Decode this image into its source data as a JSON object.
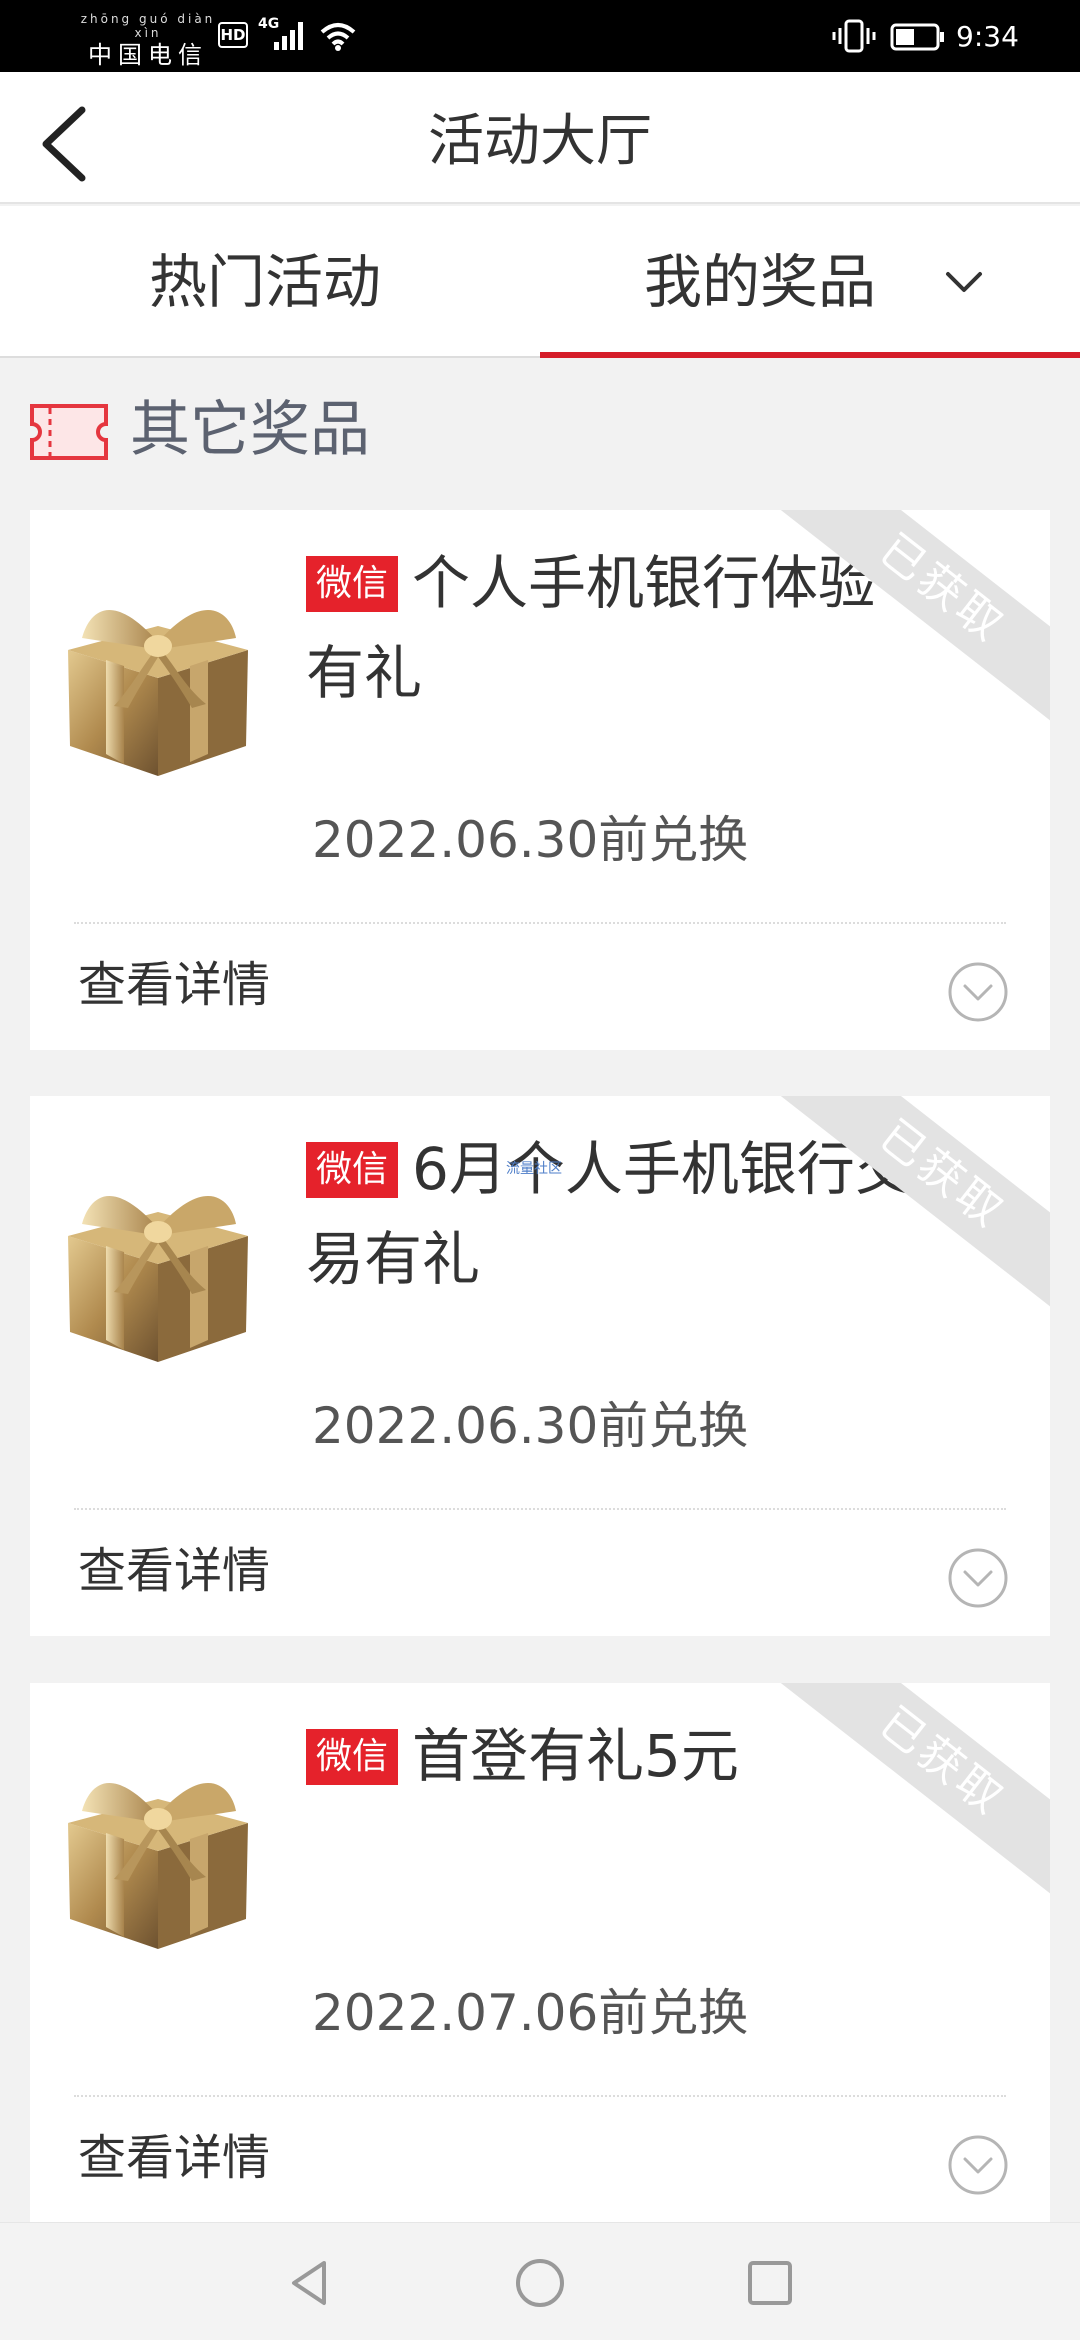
{
  "status_bar": {
    "carrier_pinyin": "zhōng guó diàn xìn",
    "carrier": "中国电信",
    "hd": "HD",
    "network": "4G",
    "time": "9:34",
    "icons": [
      "signal-icon",
      "wifi-icon",
      "vibrate-icon",
      "battery-icon"
    ]
  },
  "header": {
    "title": "活动大厅",
    "back_icon": "back-arrow-icon"
  },
  "tabs": [
    {
      "label": "热门活动",
      "active": false
    },
    {
      "label": "我的奖品",
      "active": true
    }
  ],
  "section": {
    "title": "其它奖品",
    "icon": "ticket-icon"
  },
  "prizes": [
    {
      "tag": "微信",
      "title": "个人手机银行体验有礼",
      "expiry": "2022.06.30前兑换",
      "status": "已获取",
      "details_label": "查看详情"
    },
    {
      "tag": "微信",
      "title": "6月个人手机银行交易有礼",
      "expiry": "2022.06.30前兑换",
      "status": "已获取",
      "details_label": "查看详情"
    },
    {
      "tag": "微信",
      "title": "首登有礼5元",
      "expiry": "2022.07.06前兑换",
      "status": "已获取",
      "details_label": "查看详情"
    }
  ],
  "watermark": "流量社区",
  "nav": {
    "icons": [
      "nav-back-icon",
      "nav-home-icon",
      "nav-recent-icon"
    ]
  },
  "colors": {
    "accent": "#d51d29",
    "tag_bg": "#e5222b",
    "ribbon": "#e3e3e3",
    "page_bg": "#f2f2f2"
  }
}
